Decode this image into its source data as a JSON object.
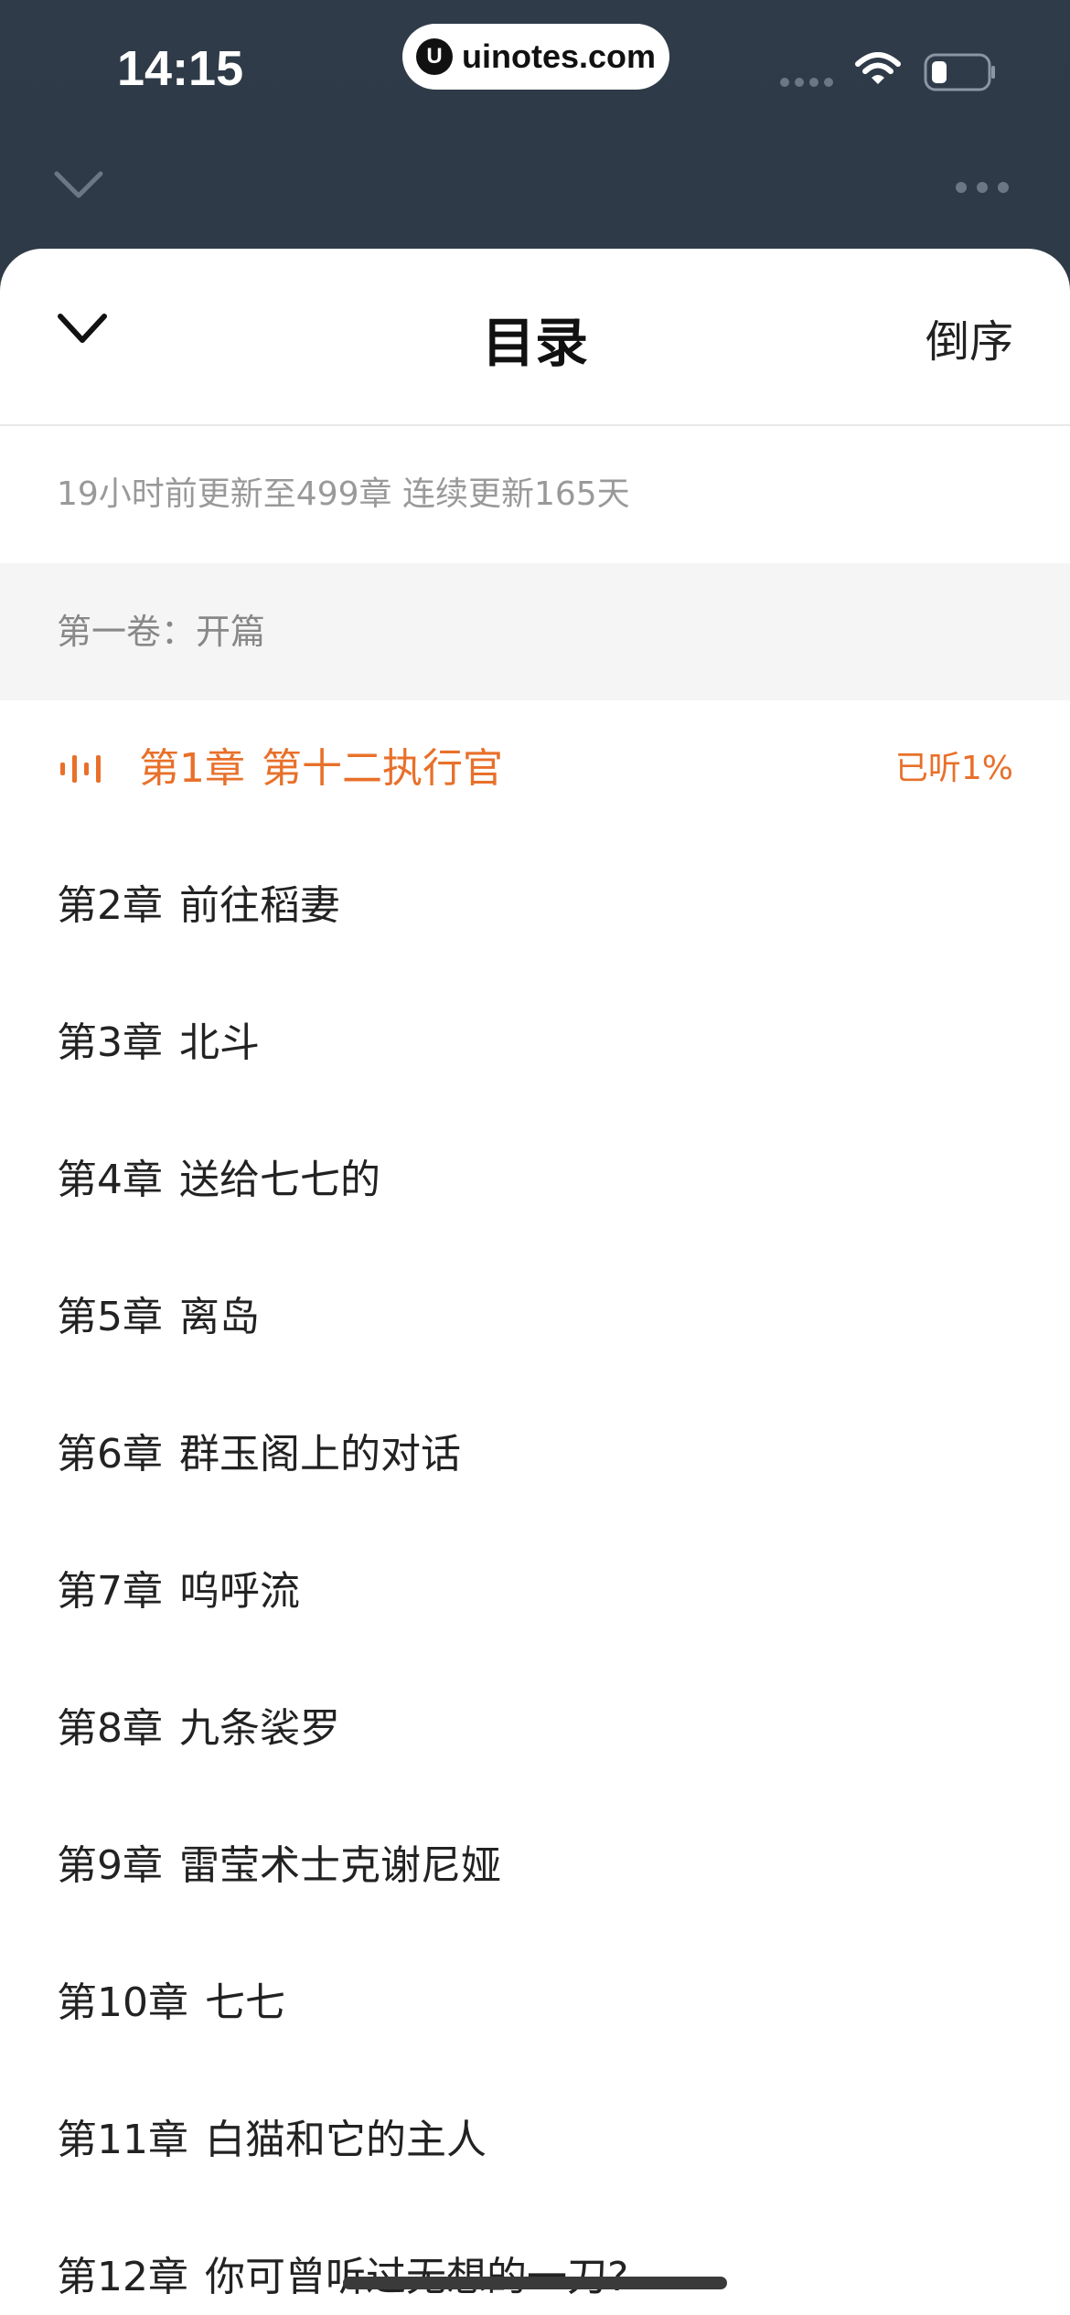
{
  "status_bar": {
    "time": "14:15",
    "url_logo": "U",
    "url": "uinotes.com",
    "icons": [
      "signal-icon",
      "wifi-icon",
      "battery-icon"
    ]
  },
  "page_header": {
    "collapse_icon": "chevron-down-icon",
    "more_icon": "more-icon"
  },
  "sheet": {
    "title": "目录",
    "sort_label": "倒序",
    "close_icon": "chevron-down-icon",
    "update_info": "19小时前更新至499章 连续更新165天",
    "volume_title": "第一卷：开篇"
  },
  "chapters": [
    {
      "num": "第1章",
      "title": "第十二执行官",
      "current": true,
      "progress": "已听1%"
    },
    {
      "num": "第2章",
      "title": "前往稻妻"
    },
    {
      "num": "第3章",
      "title": "北斗"
    },
    {
      "num": "第4章",
      "title": "送给七七的"
    },
    {
      "num": "第5章",
      "title": "离岛"
    },
    {
      "num": "第6章",
      "title": "群玉阁上的对话"
    },
    {
      "num": "第7章",
      "title": "呜呼流"
    },
    {
      "num": "第8章",
      "title": "九条裟罗"
    },
    {
      "num": "第9章",
      "title": "雷莹术士克谢尼娅"
    },
    {
      "num": "第10章",
      "title": "七七"
    },
    {
      "num": "第11章",
      "title": "白猫和它的主人"
    },
    {
      "num": "第12章",
      "title": "你可曾听过无想的一刀?"
    }
  ],
  "colors": {
    "accent": "#e8702a",
    "header_bg": "#2f3b48",
    "volume_bg": "#f5f5f5"
  }
}
